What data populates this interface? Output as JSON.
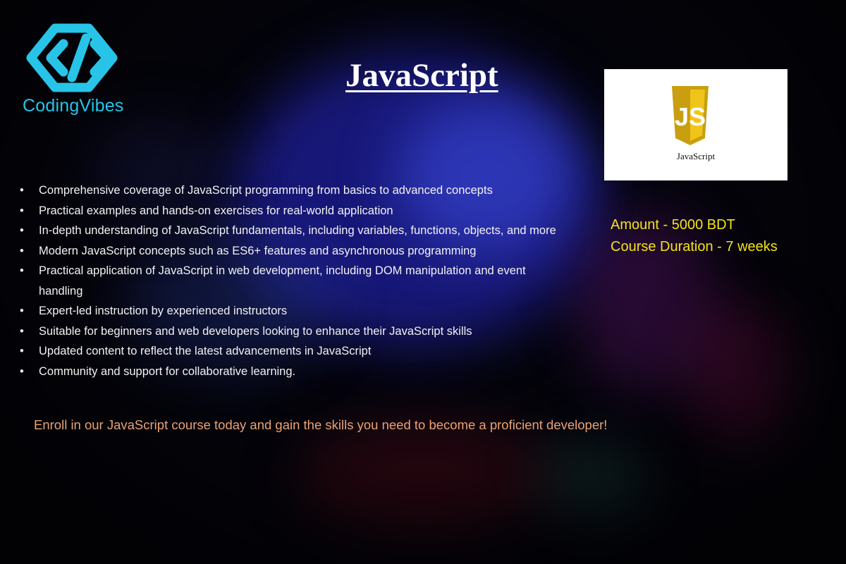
{
  "brand": {
    "name": "CodingVibes",
    "logo_icon": "code-brackets-logo",
    "color": "#27c4e8"
  },
  "title": "JavaScript",
  "badge": {
    "label": "JavaScript",
    "icon": "js-shield-icon",
    "color": "#f0c419"
  },
  "info": {
    "amount": "Amount - 5000 BDT",
    "duration": "Course Duration - 7 weeks",
    "color": "#f3e316"
  },
  "features": [
    "Comprehensive  coverage of JavaScript programming from basics to advanced concepts",
    "Practical examples and hands-on exercises for real-world application",
    "In-depth understanding of JavaScript fundamentals, including variables, functions, objects, and more",
    "Modern JavaScript concepts such as ES6+ features and asynchronous programming",
    "Practical application of JavaScript in web development, including DOM manipulation and event handling",
    "Expert-led instruction by experienced instructors",
    "Suitable for beginners and web developers looking to enhance their JavaScript skills",
    "Updated content to reflect the latest advancements in JavaScript",
    "Community and support for collaborative learning."
  ],
  "enroll": "Enroll in our JavaScript course today and gain the skills you need to become a proficient developer!"
}
